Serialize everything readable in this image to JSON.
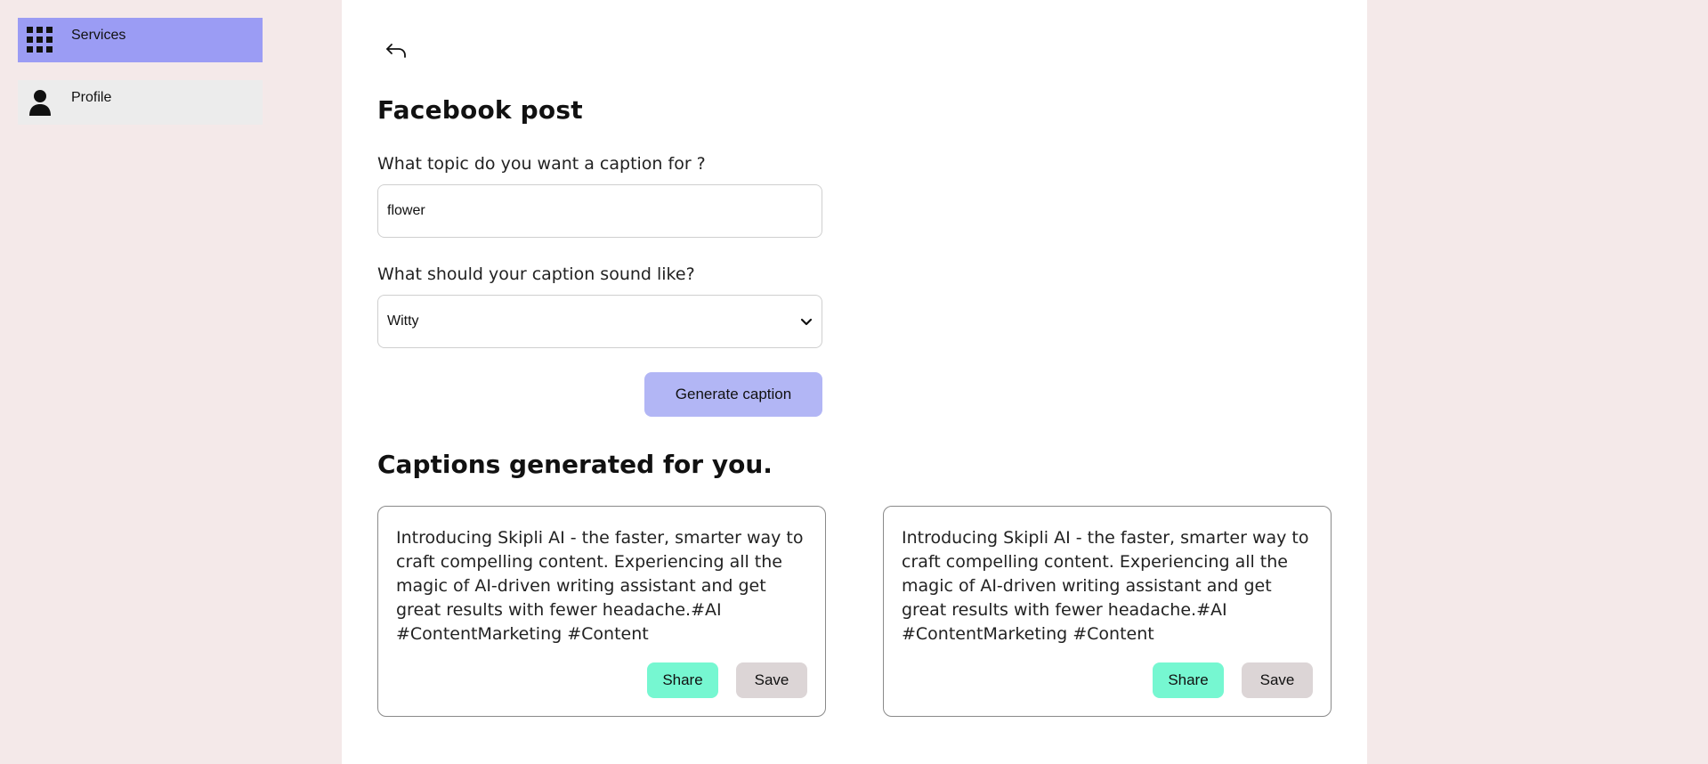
{
  "sidebar": {
    "items": [
      {
        "label": "Services",
        "icon": "grid-icon",
        "active": true
      },
      {
        "label": "Profile",
        "icon": "person-icon",
        "active": false
      }
    ]
  },
  "main": {
    "back_icon": "back-arrow-icon",
    "title": "Facebook post",
    "topic": {
      "label": "What topic do you want a caption for ?",
      "value": "flower"
    },
    "tone": {
      "label": "What should your caption sound like?",
      "selected": "Witty"
    },
    "generate_label": "Generate caption",
    "results_title": "Captions generated for you.",
    "captions": [
      {
        "text": "Introducing Skipli AI - the faster, smarter way to craft compelling content. Experiencing all the magic of AI-driven writing assistant and get great results with fewer headache.#AI #ContentMarketing #Content",
        "share_label": "Share",
        "save_label": "Save"
      },
      {
        "text": "Introducing Skipli AI - the faster, smarter way to craft compelling content. Experiencing all the magic of AI-driven writing assistant and get great results with fewer headache.#AI #ContentMarketing #Content",
        "share_label": "Share",
        "save_label": "Save"
      }
    ]
  },
  "colors": {
    "page_bg": "#f4e9e9",
    "active_nav": "#9b9cf4",
    "generate_button": "#b2b6f5",
    "share_button": "#76f7d1",
    "save_button": "#dcd5d6"
  }
}
